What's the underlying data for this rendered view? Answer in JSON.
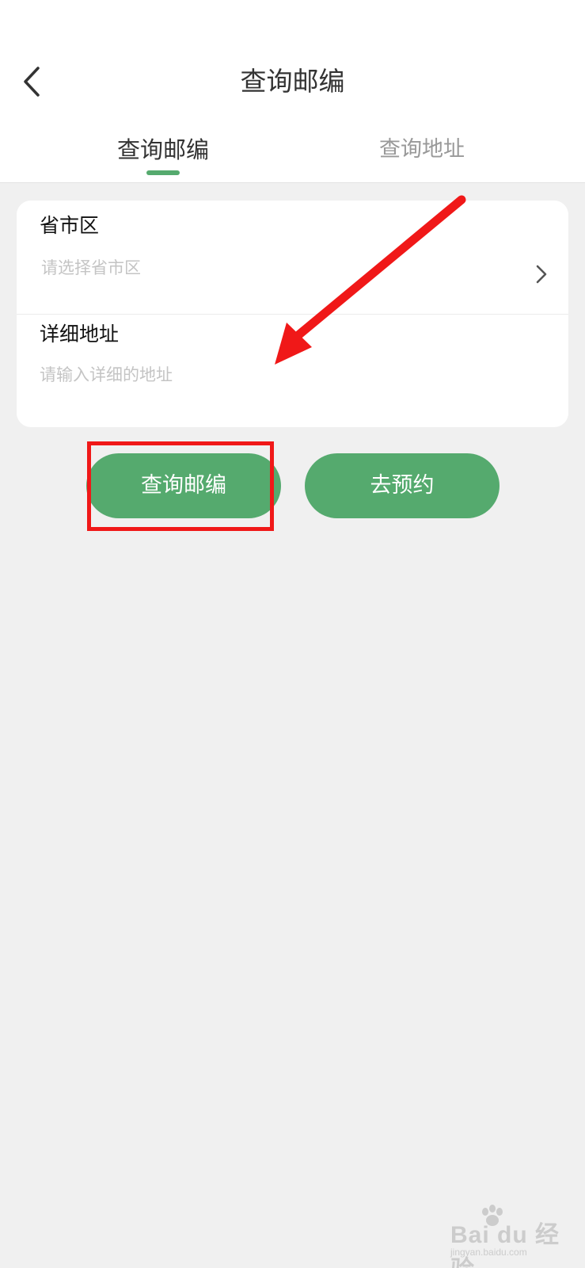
{
  "nav": {
    "title": "查询邮编",
    "back_icon": "chevron-left-icon"
  },
  "tabs": [
    {
      "label": "查询邮编",
      "active": true
    },
    {
      "label": "查询地址",
      "active": false
    }
  ],
  "form": {
    "region": {
      "label": "省市区",
      "placeholder": "请选择省市区"
    },
    "address": {
      "label": "详细地址",
      "placeholder": "请输入详细的地址",
      "value": ""
    }
  },
  "buttons": {
    "query_label": "查询邮编",
    "book_label": "去预约"
  },
  "watermark": {
    "main": "Bai du 经验",
    "sub": "jingyan.baidu.com"
  },
  "colors": {
    "accent": "#55aa6e",
    "annotation": "#f01818",
    "background": "#f0f0f0"
  }
}
